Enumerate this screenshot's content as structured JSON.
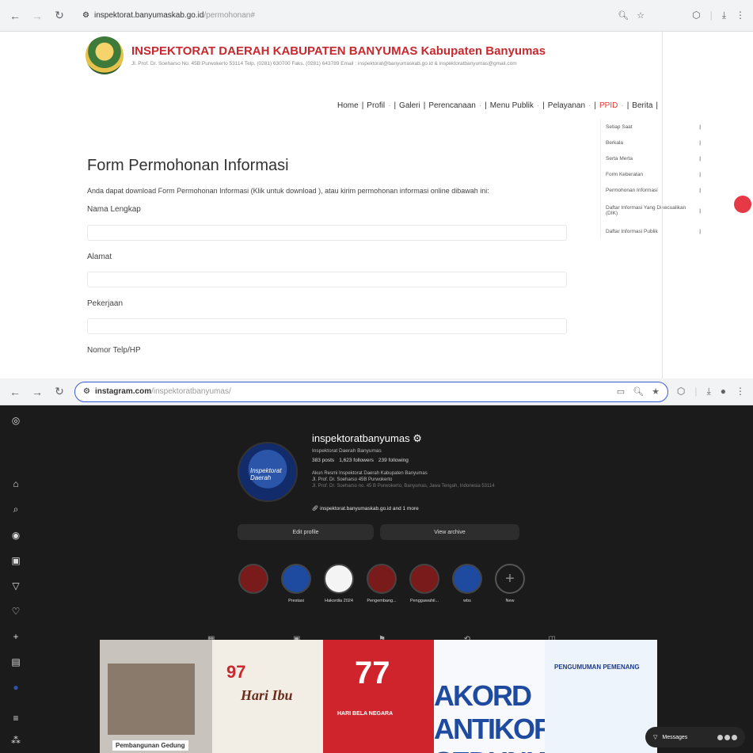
{
  "browser1": {
    "url_domain": "inspektorat.banyumaskab.go.id",
    "url_path": "/permohonan#"
  },
  "site": {
    "title": "INSPEKTORAT DAERAH KABUPATEN BANYUMAS",
    "title_suffix": "Kabupaten Banyumas",
    "address": "Jl. Prof. Dr. Soeharso No. 45B Purwokerto 53114 Telp. (0281) 630700 Faks. (0281) 643789 Email : inspektorat@banyumaskab.go.id & inspektoratbanyumas@gmail.com",
    "menu": [
      "Home",
      "Profil",
      "Galeri",
      "Perencanaan",
      "Menu Publik",
      "Pelayanan",
      "PPID",
      "Berita"
    ],
    "dropdown": [
      "Setiap Saat",
      "Berkala",
      "Serta Merta",
      "Form Keberatan",
      "Permohonan Informasi",
      "Daftar Informasi Yang Dikecualikan (DIK)",
      "Daftar Informasi Publik"
    ]
  },
  "form": {
    "title": "Form Permohonan Informasi",
    "desc": "Anda dapat download Form Permohonan Informasi (Klik untuk download ), atau kirim permohonan informasi online dibawah ini:",
    "fields": [
      "Nama Lengkap",
      "Alamat",
      "Pekerjaan",
      "Nomor Telp/HP"
    ]
  },
  "browser2": {
    "url_domain": "instagram.com",
    "url_path": "/inspektoratbanyumas/"
  },
  "ig": {
    "handle": "inspektoratbanyumas",
    "name": "Inspektorat Daerah Banyumas",
    "posts": "383 posts",
    "followers": "1,623 followers",
    "following": "239 following",
    "bio1": "Akun Resmi Inspektorat Daerah Kabupaten Banyumas",
    "bio2": "Jl. Prof. Dr. Soeharso 45B Purwokerto",
    "bio3": "Jl. Prof. Dr. Soeharso no. 45 B Purwokerto, Banyumas, Jawa Tengah, Indonesia 53114",
    "link": "inspektorat.banyumaskab.go.id and 1 more",
    "avatar_text": "Inspektorat Daerah",
    "edit": "Edit profile",
    "archive": "View archive",
    "highlights": [
      "",
      "Prestasi",
      "Hakordia 2024",
      "Pengembang...",
      "Penggawahil...",
      "wbs",
      "New"
    ],
    "posts_tiles": [
      "Pembangunan Gedung",
      "Hari Ibu",
      "HARI BELA NEGARA",
      "AKORD ANTIKORUPSI SEDUNIA",
      "PENGUMUMAN PEMENANG"
    ],
    "messages": "Messages"
  }
}
